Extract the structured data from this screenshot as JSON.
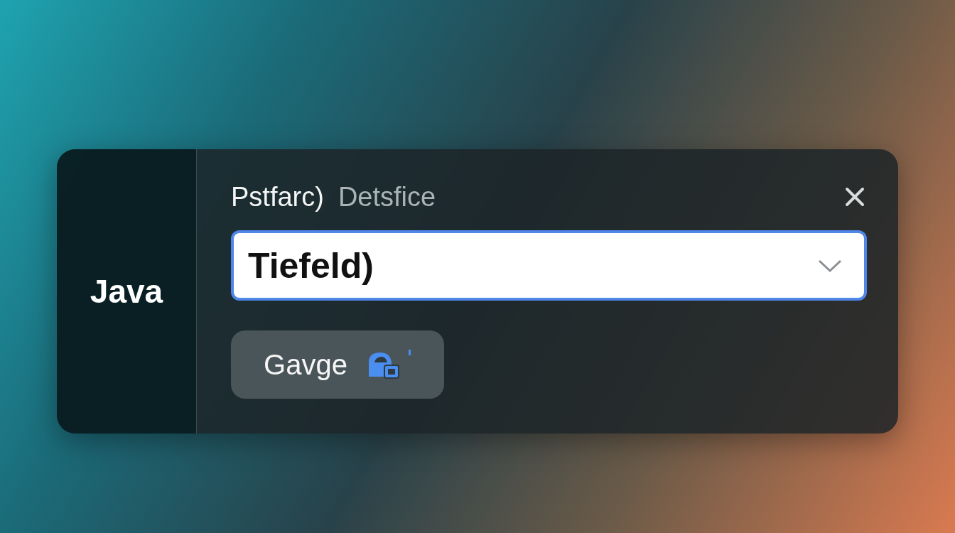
{
  "sidebar": {
    "label": "Java"
  },
  "header": {
    "title": "Pstfarc)",
    "subtitle": "Detsfice"
  },
  "dropdown": {
    "value": "Tiefeld)"
  },
  "button": {
    "label": "Gavge"
  }
}
